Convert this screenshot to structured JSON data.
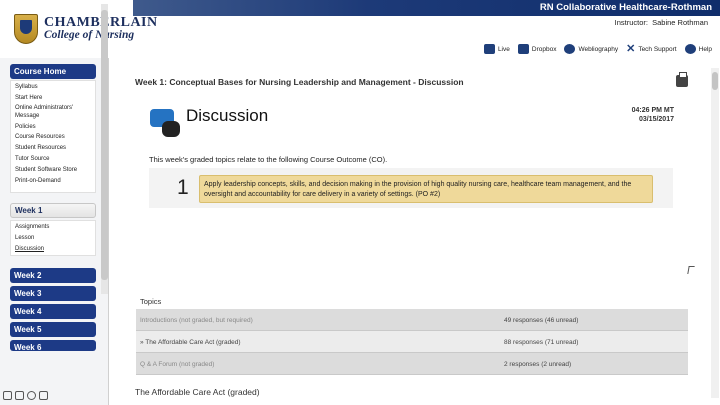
{
  "header": {
    "course_title": "RN Collaborative Healthcare-Rothman",
    "instructor_label": "Instructor:",
    "instructor_name": "Sabine Rothman",
    "logo_line1": "CHAMBERLAIN",
    "logo_line2": "College of Nursing",
    "toolbar": [
      {
        "label": "Live",
        "icon": "video-camera-icon"
      },
      {
        "label": "Dropbox",
        "icon": "dropbox-icon"
      },
      {
        "label": "Webliography",
        "icon": "globe-icon"
      },
      {
        "label": "Tech Support",
        "icon": "wrench-icon"
      },
      {
        "label": "Help",
        "icon": "info-icon"
      }
    ]
  },
  "sidebar": {
    "course_home": "Course Home",
    "course_links": [
      "Syllabus",
      "Start Here",
      "Online Administrators' Message",
      "Policies",
      "Course Resources",
      "Student Resources",
      "Tutor Source",
      "Student Software Store",
      "Print-on-Demand"
    ],
    "week1": "Week 1",
    "week1_links": [
      "Assignments",
      "Lesson",
      "Discussion"
    ],
    "weeks": [
      "Week 2",
      "Week 3",
      "Week 4",
      "Week 5",
      "Week 6"
    ]
  },
  "main": {
    "heading": "Week 1: Conceptual Bases for Nursing Leadership and Management - Discussion",
    "title": "Discussion",
    "time": "04:26 PM MT",
    "date": "03/15/2017",
    "intro": "This week's graded topics relate to the following Course Outcome (CO).",
    "outcome_number": "1",
    "outcome_text": "Apply leadership concepts, skills, and decision making in the provision of high quality nursing care, healthcare team management, and the oversight and accountability for care delivery in a variety of settings. (PO #2)",
    "topics_label": "Topics",
    "topics": [
      {
        "name": "Introductions (not graded, but required)",
        "responses": "49 responses (46 unread)"
      },
      {
        "name": "» The Affordable Care Act (graded)",
        "responses": "88 responses (71 unread)"
      },
      {
        "name": "Q & A Forum (not graded)",
        "responses": "2 responses (2 unread)"
      }
    ],
    "section_title": "The Affordable Care Act (graded)"
  }
}
